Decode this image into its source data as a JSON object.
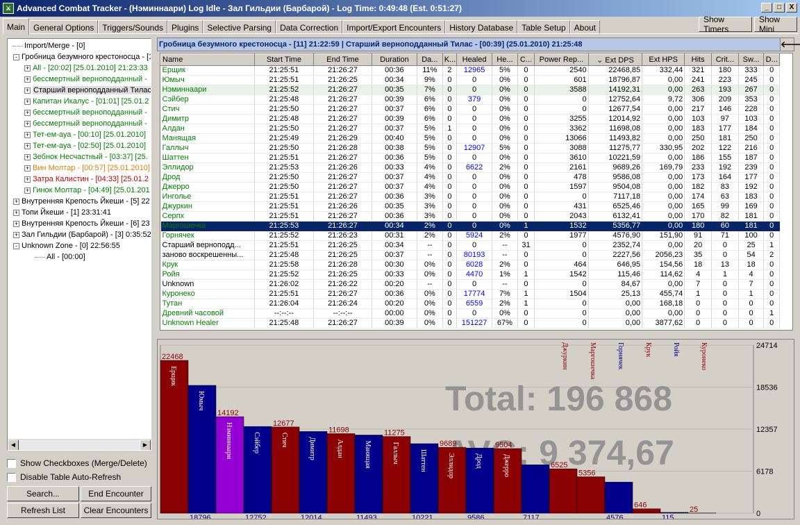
{
  "window": {
    "title": "Advanced Combat Tracker - (Нэминнаари) Log Idle - Зал Гильдии (Барбарой) - Log Time: 0:49:48 (Est. 0:51:27)",
    "icon": "act-app-icon",
    "min_label": "_",
    "max_label": "□",
    "close_label": "X"
  },
  "tabs": [
    "Main",
    "General Options",
    "Triggers/Sounds",
    "Plugins",
    "Selective Parsing",
    "Data Correction",
    "Import/Export Encounters",
    "History Database",
    "Table Setup",
    "About"
  ],
  "top_buttons": {
    "show_timers": "Show Timers",
    "show_mini": "Show Mini"
  },
  "tree": [
    {
      "text": "Import/Merge - [0]",
      "level": 0,
      "box": "",
      "color": "#000000"
    },
    {
      "text": "Гробница безумного крестоносца - [1",
      "level": 0,
      "box": "-",
      "color": "#000000"
    },
    {
      "text": "All - [20:02] [25.01.2010] 21:23:33",
      "level": 1,
      "box": "+",
      "color": "#008000"
    },
    {
      "text": "бессмертный верноподданный -",
      "level": 1,
      "box": "+",
      "color": "#008000"
    },
    {
      "text": "Старший верноподданный Тилас",
      "level": 1,
      "box": "+",
      "color": "#000000",
      "selected": true
    },
    {
      "text": "Капитан Икалус - [01:01] [25.01.2",
      "level": 1,
      "box": "+",
      "color": "#008000"
    },
    {
      "text": "бессмертный верноподданный -",
      "level": 1,
      "box": "+",
      "color": "#008000"
    },
    {
      "text": "бессмертный верноподданный -",
      "level": 1,
      "box": "+",
      "color": "#008000"
    },
    {
      "text": "Тет-ем-ауа - [00:10] [25.01.2010]",
      "level": 1,
      "box": "+",
      "color": "#008000"
    },
    {
      "text": "Тет-ем-ауа - [02:50] [25.01.2010]",
      "level": 1,
      "box": "+",
      "color": "#008000"
    },
    {
      "text": "Зебнок Несчастный - [03:37] [25.",
      "level": 1,
      "box": "+",
      "color": "#008000"
    },
    {
      "text": "Вин Молтар - [00:57] [25.01.2010]",
      "level": 1,
      "box": "+",
      "color": "#e08000"
    },
    {
      "text": "Затра Калистин - [04:33] [25.01.2",
      "level": 1,
      "box": "+",
      "color": "#c00000"
    },
    {
      "text": "Гинок Молтар - [04:49] [25.01.201",
      "level": 1,
      "box": "+",
      "color": "#008000"
    },
    {
      "text": "Внутренняя Крепость Йкеши - [5] 22",
      "level": 0,
      "box": "+",
      "color": "#000000"
    },
    {
      "text": "Топи Йкеши - [1] 23:31:41",
      "level": 0,
      "box": "+",
      "color": "#000000"
    },
    {
      "text": "Внутренняя Крепость Йкеши - [6] 23",
      "level": 0,
      "box": "+",
      "color": "#000000"
    },
    {
      "text": "Зал Гильдии (Барбарой) - [3] 0:35:52",
      "level": 0,
      "box": "+",
      "color": "#000000"
    },
    {
      "text": "Unknown Zone - [0] 22:56:55",
      "level": 0,
      "box": "-",
      "color": "#000000"
    },
    {
      "text": "All - [00:00]",
      "level": 2,
      "box": "",
      "color": "#000000"
    }
  ],
  "checkboxes": {
    "show_checkboxes": "Show Checkboxes (Merge/Delete)",
    "disable_refresh": "Disable Table Auto-Refresh"
  },
  "buttons": {
    "search": "Search...",
    "end_encounter": "End Encounter",
    "refresh": "Refresh List",
    "clear": "Clear Encounters"
  },
  "encounter_header": "Гробница безумного крестоносца - [11] 21:22:59  |  Старший верноподданный Тилас - [00:39] (25.01.2010) 21:25:48",
  "table": {
    "columns": [
      "Name",
      "Start Time",
      "End Time",
      "Duration",
      "Da...",
      "K...",
      "Healed",
      "He...",
      "C...",
      "Power Rep...",
      "⌄ Ext DPS",
      "Ext HPS",
      "Hits",
      "Crit...",
      "Sw...",
      "D..."
    ],
    "rows": [
      [
        "Ерщик",
        "21:25:51",
        "21:26:27",
        "00:36",
        "11%",
        "2",
        "12965",
        "5%",
        "0",
        "2540",
        "22468,85",
        "332,44",
        "321",
        "180",
        "333",
        "0"
      ],
      [
        "Юмыч",
        "21:25:51",
        "21:26:25",
        "00:34",
        "9%",
        "0",
        "0",
        "0%",
        "0",
        "601",
        "18796,87",
        "0,00",
        "241",
        "223",
        "245",
        "0"
      ],
      [
        "Нэминнаари",
        "21:25:52",
        "21:26:27",
        "00:35",
        "7%",
        "0",
        "0",
        "0%",
        "0",
        "3588",
        "14192,31",
        "0,00",
        "263",
        "193",
        "267",
        "0"
      ],
      [
        "Сэйбер",
        "21:25:48",
        "21:26:27",
        "00:39",
        "6%",
        "0",
        "379",
        "0%",
        "0",
        "0",
        "12752,64",
        "9,72",
        "306",
        "209",
        "353",
        "0"
      ],
      [
        "Стич",
        "21:25:50",
        "21:26:27",
        "00:37",
        "6%",
        "0",
        "0",
        "0%",
        "0",
        "0",
        "12677,54",
        "0,00",
        "217",
        "146",
        "228",
        "0"
      ],
      [
        "Димитр",
        "21:25:48",
        "21:26:27",
        "00:39",
        "6%",
        "0",
        "0",
        "0%",
        "0",
        "3255",
        "12014,92",
        "0,00",
        "103",
        "97",
        "103",
        "0"
      ],
      [
        "Алдан",
        "21:25:50",
        "21:26:27",
        "00:37",
        "5%",
        "1",
        "0",
        "0%",
        "0",
        "3362",
        "11698,08",
        "0,00",
        "183",
        "177",
        "184",
        "0"
      ],
      [
        "Манящая",
        "21:25:49",
        "21:26:29",
        "00:40",
        "5%",
        "0",
        "0",
        "0%",
        "0",
        "13066",
        "11493,82",
        "0,00",
        "250",
        "181",
        "250",
        "0"
      ],
      [
        "Галлыч",
        "21:25:50",
        "21:26:28",
        "00:38",
        "5%",
        "0",
        "12907",
        "5%",
        "0",
        "3088",
        "11275,77",
        "330,95",
        "202",
        "122",
        "216",
        "0"
      ],
      [
        "Шаттен",
        "21:25:51",
        "21:26:27",
        "00:36",
        "5%",
        "0",
        "0",
        "0%",
        "0",
        "3610",
        "10221,59",
        "0,00",
        "186",
        "155",
        "187",
        "0"
      ],
      [
        "Эллидор",
        "21:25:53",
        "21:26:26",
        "00:33",
        "4%",
        "0",
        "6622",
        "2%",
        "0",
        "2161",
        "9689,26",
        "169,79",
        "233",
        "192",
        "239",
        "0"
      ],
      [
        "Дрод",
        "21:25:50",
        "21:26:27",
        "00:37",
        "4%",
        "0",
        "0",
        "0%",
        "0",
        "478",
        "9586,08",
        "0,00",
        "173",
        "164",
        "177",
        "0"
      ],
      [
        "Джерро",
        "21:25:50",
        "21:26:27",
        "00:37",
        "4%",
        "0",
        "0",
        "0%",
        "0",
        "1597",
        "9504,08",
        "0,00",
        "182",
        "83",
        "192",
        "0"
      ],
      [
        "Инголье",
        "21:25:51",
        "21:26:27",
        "00:36",
        "3%",
        "0",
        "0",
        "0%",
        "0",
        "0",
        "7117,18",
        "0,00",
        "174",
        "63",
        "183",
        "0"
      ],
      [
        "Джуркин",
        "21:25:51",
        "21:26:26",
        "00:35",
        "3%",
        "0",
        "0",
        "0%",
        "0",
        "431",
        "6525,46",
        "0,00",
        "165",
        "99",
        "169",
        "0"
      ],
      [
        "Серпх",
        "21:25:51",
        "21:26:27",
        "00:36",
        "3%",
        "0",
        "0",
        "0%",
        "0",
        "2043",
        "6132,41",
        "0,00",
        "170",
        "82",
        "181",
        "0"
      ],
      [
        "Маргошечка",
        "21:25:53",
        "21:26:27",
        "00:34",
        "2%",
        "0",
        "0",
        "0%",
        "1",
        "1532",
        "5356,77",
        "0,00",
        "180",
        "60",
        "181",
        "0"
      ],
      [
        "Горнячек",
        "21:25:52",
        "21:26:23",
        "00:31",
        "2%",
        "0",
        "5924",
        "2%",
        "0",
        "1977",
        "4576,90",
        "151,90",
        "91",
        "71",
        "100",
        "0"
      ],
      [
        "Старший верноподд...",
        "21:25:51",
        "21:26:25",
        "00:34",
        "--",
        "0",
        "0",
        "--",
        "31",
        "0",
        "2352,74",
        "0,00",
        "20",
        "0",
        "25",
        "1"
      ],
      [
        "заново воскрешенны...",
        "21:25:48",
        "21:26:25",
        "00:37",
        "--",
        "0",
        "80193",
        "--",
        "0",
        "0",
        "2227,56",
        "2056,23",
        "35",
        "0",
        "54",
        "2"
      ],
      [
        "Крук",
        "21:25:58",
        "21:26:28",
        "00:30",
        "0%",
        "0",
        "6028",
        "2%",
        "0",
        "464",
        "646,95",
        "154,56",
        "18",
        "13",
        "18",
        "0"
      ],
      [
        "Ройя",
        "21:25:52",
        "21:26:25",
        "00:33",
        "0%",
        "0",
        "4470",
        "1%",
        "1",
        "1542",
        "115,46",
        "114,62",
        "4",
        "1",
        "4",
        "0"
      ],
      [
        "Unknown",
        "21:26:02",
        "21:26:22",
        "00:20",
        "--",
        "0",
        "0",
        "--",
        "0",
        "0",
        "84,67",
        "0,00",
        "7",
        "0",
        "7",
        "0"
      ],
      [
        "Куронеко",
        "21:25:51",
        "21:26:27",
        "00:36",
        "0%",
        "0",
        "17774",
        "7%",
        "1",
        "1504",
        "25,13",
        "455,74",
        "1",
        "0",
        "1",
        "0"
      ],
      [
        "Тутан",
        "21:26:04",
        "21:26:24",
        "00:20",
        "0%",
        "0",
        "6559",
        "2%",
        "1",
        "0",
        "0,00",
        "168,18",
        "0",
        "0",
        "0",
        "0"
      ],
      [
        "Древний часовой",
        "--:--:--",
        "--:--:--",
        "00:00",
        "0%",
        "0",
        "0",
        "0%",
        "0",
        "0",
        "0,00",
        "0,00",
        "0",
        "0",
        "0",
        "1"
      ],
      [
        "Unknown Healer",
        "21:25:48",
        "21:26:27",
        "00:39",
        "0%",
        "0",
        "151227",
        "67%",
        "0",
        "0",
        "0,00",
        "3877,62",
        "0",
        "0",
        "0",
        "0"
      ]
    ],
    "row_styles": [
      "ally",
      "ally",
      "hl",
      "ally",
      "ally",
      "ally",
      "ally",
      "ally",
      "ally",
      "ally",
      "ally",
      "ally",
      "ally",
      "ally",
      "ally",
      "ally",
      "sel",
      "ally",
      "other",
      "other",
      "ally",
      "ally",
      "other",
      "ally",
      "ally",
      "ally",
      "ally"
    ]
  },
  "chart_data": {
    "type": "bar",
    "categories": [
      "Ерщик",
      "Юмыч",
      "Нэминнаари",
      "Сэйбер",
      "Стич",
      "Димитр",
      "Алдан",
      "Манящая",
      "Галлыч",
      "Шаттен",
      "Эллидор",
      "Дрод",
      "Джерро",
      "Инголье",
      "Джуркин",
      "Маргошечка",
      "Горнячек",
      "Крук",
      "Ройя",
      "Куронеко"
    ],
    "values": [
      22468,
      18796,
      14192,
      12752,
      12677,
      12014,
      11698,
      11493,
      11275,
      10221,
      9689,
      9586,
      9504,
      7117,
      6525,
      5356,
      4576,
      646,
      115,
      25
    ],
    "colors": [
      "#8b0000",
      "#00008b",
      "#9400d3",
      "#00008b",
      "#8b0000",
      "#00008b",
      "#8b0000",
      "#00008b",
      "#8b0000",
      "#00008b",
      "#8b0000",
      "#00008b",
      "#8b0000",
      "#00008b",
      "#8b0000",
      "#8b0000",
      "#00008b",
      "#8b0000",
      "#00008b",
      "#8b0000"
    ],
    "value_labels_top": [
      22468,
      null,
      14192,
      null,
      12677,
      null,
      11698,
      null,
      11275,
      null,
      9689,
      null,
      9504,
      null,
      6525,
      5356,
      null,
      646,
      null,
      25
    ],
    "value_labels_bottom": [
      null,
      18796,
      null,
      12752,
      null,
      12014,
      null,
      11493,
      null,
      10221,
      null,
      9586,
      null,
      7117,
      null,
      null,
      4576,
      null,
      115,
      null
    ],
    "rotated_labels_above": [
      "Джуркин",
      "Маргошечка",
      "Горнячек",
      "Крук",
      "Ройя",
      "Куронеко"
    ],
    "ylim": [
      0,
      24714
    ],
    "yticks": [
      "24714",
      "18536",
      "12357",
      "6178",
      "0"
    ],
    "total_label": "Total: 196 868",
    "avg_label": "AVG: 9 374,67"
  }
}
